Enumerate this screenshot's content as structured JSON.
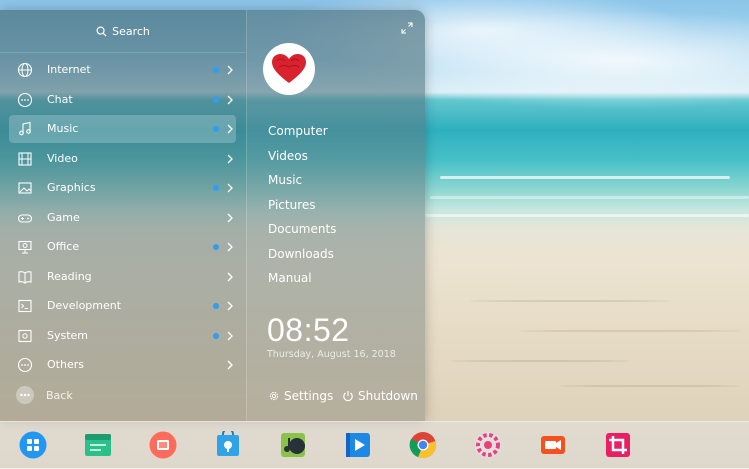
{
  "search": {
    "placeholder": "Search"
  },
  "categories": [
    {
      "label": "Internet",
      "new": true
    },
    {
      "label": "Chat",
      "new": true
    },
    {
      "label": "Music",
      "new": true
    },
    {
      "label": "Video",
      "new": false
    },
    {
      "label": "Graphics",
      "new": true
    },
    {
      "label": "Game",
      "new": false
    },
    {
      "label": "Office",
      "new": true
    },
    {
      "label": "Reading",
      "new": false
    },
    {
      "label": "Development",
      "new": true
    },
    {
      "label": "System",
      "new": true
    },
    {
      "label": "Others",
      "new": false
    }
  ],
  "selected_category": "Music",
  "back_label": "Back",
  "places": [
    "Computer",
    "Videos",
    "Music",
    "Pictures",
    "Documents",
    "Downloads",
    "Manual"
  ],
  "clock": {
    "time": "08:52",
    "date": "Thursday, August 16, 2018"
  },
  "actions": {
    "settings": "Settings",
    "shutdown": "Shutdown"
  },
  "dock": {
    "apps": [
      "launcher",
      "file-manager",
      "video-recorder",
      "app-store",
      "music-player",
      "movie-player",
      "chrome",
      "system-settings",
      "screen-recorder",
      "screenshot"
    ]
  },
  "colors": {
    "accent": "#2f9df4"
  }
}
